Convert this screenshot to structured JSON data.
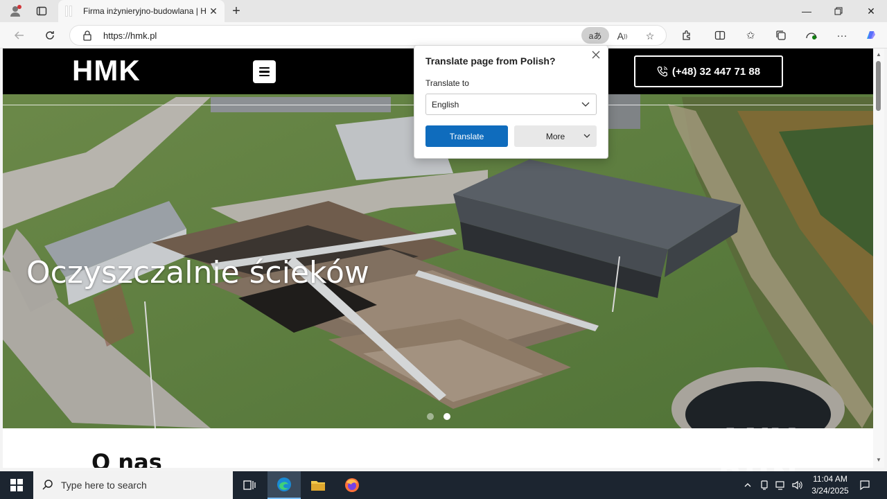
{
  "browser": {
    "tab_title": "Firma inżynieryjno-budowlana | H",
    "url": "https://hmk.pl",
    "translate_pill": "aあ"
  },
  "site": {
    "logo": "HMK",
    "phone": "(+48) 32 447 71 88",
    "hero_heading": "Oczyszczalnie ścieków",
    "section_title": "O nas",
    "carousel_active_index": 2,
    "carousel_count": 2
  },
  "translate_popup": {
    "title": "Translate page from Polish?",
    "translate_to_label": "Translate to",
    "selected_language": "English",
    "translate_button": "Translate",
    "more_button": "More"
  },
  "taskbar": {
    "search_placeholder": "Type here to search",
    "time": "11:04 AM",
    "date": "3/24/2025"
  },
  "watermark": "ANY RUN",
  "colors": {
    "accent": "#0f6cbd",
    "header_bg": "#000000",
    "taskbar_bg": "#1c2530"
  }
}
